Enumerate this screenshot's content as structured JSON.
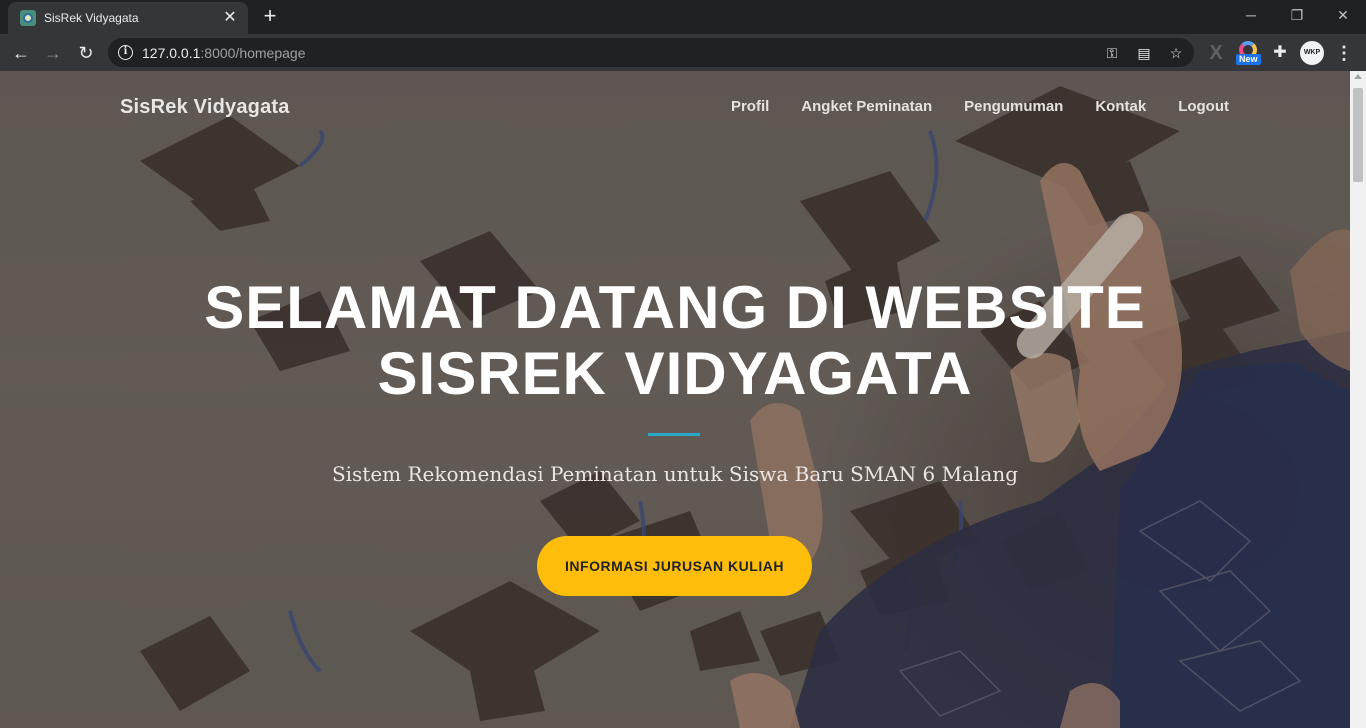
{
  "browser": {
    "tab_title": "SisRek Vidyagata",
    "url_host": "127.0.0.1",
    "url_path": ":8000/homepage",
    "extension_badge": "New",
    "avatar_text": "WKP"
  },
  "navbar": {
    "brand": "SisRek Vidyagata",
    "links": [
      "Profil",
      "Angket Peminatan",
      "Pengumuman",
      "Kontak",
      "Logout"
    ]
  },
  "hero": {
    "title_line1": "SELAMAT DATANG DI WEBSITE",
    "title_line2": "SISREK VIDYAGATA",
    "subtitle": "Sistem Rekomendasi Peminatan untuk Siswa Baru SMAN 6 Malang",
    "cta_label": "INFORMASI JURUSAN KULIAH"
  },
  "colors": {
    "accent_divider": "#2aa6c6",
    "cta_background": "#fdbd0a"
  }
}
